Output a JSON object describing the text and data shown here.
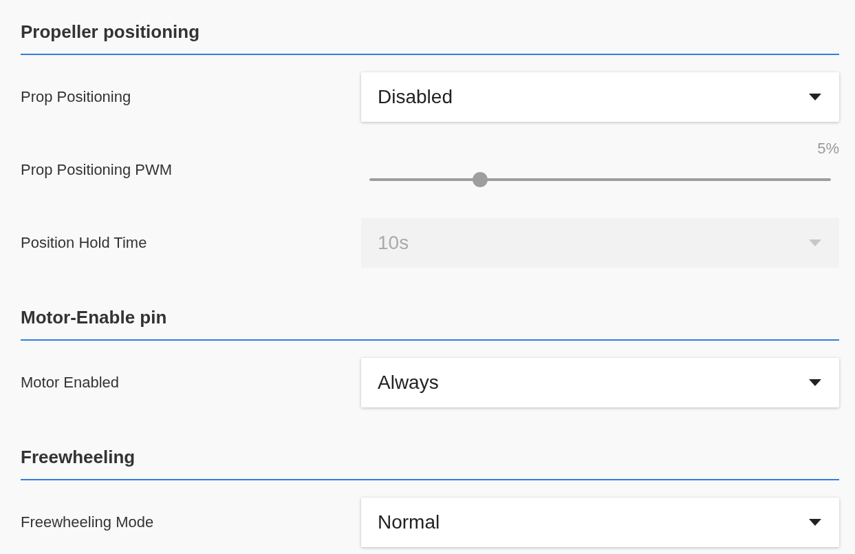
{
  "sections": [
    {
      "title": "Propeller positioning",
      "settings": [
        {
          "kind": "select",
          "label": "Prop Positioning",
          "value": "Disabled",
          "disabled": false
        },
        {
          "kind": "slider",
          "label": "Prop Positioning PWM",
          "level": 0.24,
          "reading": "5%"
        },
        {
          "kind": "select",
          "label": "Position Hold Time",
          "value": "10s",
          "disabled": true
        }
      ]
    },
    {
      "title": "Motor-Enable pin",
      "settings": [
        {
          "kind": "select",
          "label": "Motor Enabled",
          "value": "Always",
          "disabled": false
        }
      ]
    },
    {
      "title": "Freewheeling",
      "settings": [
        {
          "kind": "select",
          "label": "Freewheeling Mode",
          "value": "Normal",
          "disabled": false
        }
      ]
    }
  ]
}
